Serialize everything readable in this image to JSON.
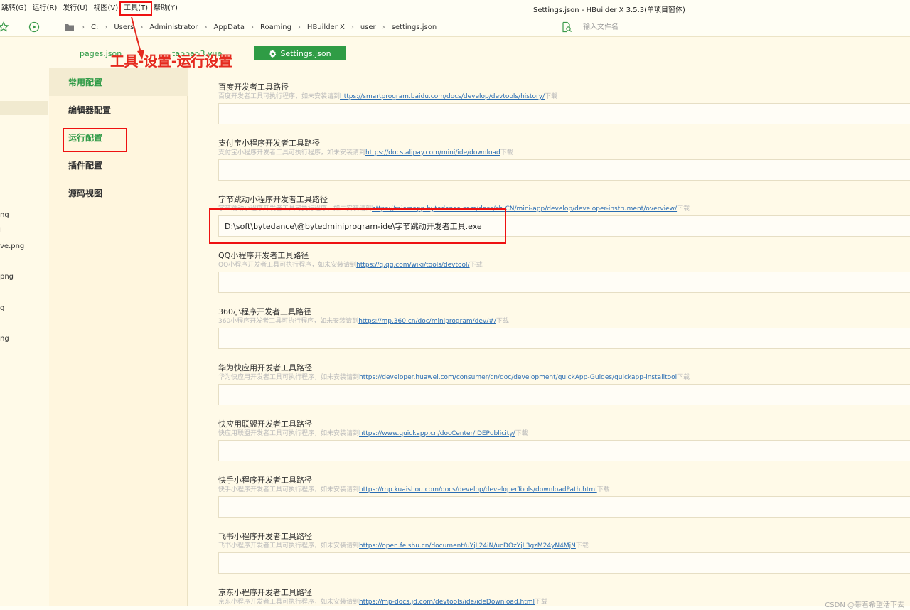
{
  "menubar": {
    "items": [
      "跳转(G)",
      "运行(R)",
      "发行(U)",
      "视图(V)",
      "工具(T)",
      "帮助(Y)"
    ],
    "window_title": "Settings.json - HBuilder X 3.5.3(单项目窗体)"
  },
  "toolbar": {
    "breadcrumbs": [
      "C:",
      "Users",
      "Administrator",
      "AppData",
      "Roaming",
      "HBuilder X",
      "user",
      "settings.json"
    ],
    "file_search_placeholder": "输入文件名"
  },
  "filetree": {
    "items": [
      "ng",
      "l",
      "ve.png",
      "png",
      "g",
      "ng"
    ]
  },
  "tabs": {
    "items": [
      "pages.json",
      "tabbar-3.vue"
    ],
    "active": "Settings.json"
  },
  "annotation": {
    "text": "工具-设置-运行设置",
    "color": "#e52a1f"
  },
  "categories": {
    "items": [
      "常用配置",
      "编辑器配置",
      "运行配置",
      "插件配置",
      "源码视图"
    ]
  },
  "settings": {
    "desc_prefix": "可执行程序，如未安装请到",
    "download_suffix": "下载",
    "fields": [
      {
        "label": "百度开发者工具路径",
        "desc_prefix": "百度开发者工具可执行程序，如未安装请到",
        "url": "https://smartprogram.baidu.com/docs/develop/devtools/history/",
        "suffix": "下载",
        "value": ""
      },
      {
        "label": "支付宝小程序开发者工具路径",
        "desc_prefix": "支付宝小程序开发者工具可执行程序，如未安装请到",
        "url": "https://docs.alipay.com/mini/ide/download",
        "suffix": "下载",
        "value": ""
      },
      {
        "label": "字节跳动小程序开发者工具路径",
        "desc_prefix": "字节跳动小程序开发者工具可执行程序，如未安装请到",
        "url": "https://microapp.bytedance.com/docs/zh-CN/mini-app/develop/developer-instrument/overview/",
        "suffix": "下载",
        "value": "D:\\soft\\bytedance\\@bytedminiprogram-ide\\字节跳动开发者工具.exe"
      },
      {
        "label": "QQ小程序开发者工具路径",
        "desc_prefix": "QQ小程序开发者工具可执行程序，如未安装请到",
        "url": "https://q.qq.com/wiki/tools/devtool/",
        "suffix": "下载",
        "value": ""
      },
      {
        "label": "360小程序开发者工具路径",
        "desc_prefix": "360小程序开发者工具可执行程序，如未安装请到",
        "url": "https://mp.360.cn/doc/miniprogram/dev/#/",
        "suffix": "下载",
        "value": ""
      },
      {
        "label": "华为快应用开发者工具路径",
        "desc_prefix": "华为快应用开发者工具可执行程序，如未安装请到",
        "url": "https://developer.huawei.com/consumer/cn/doc/development/quickApp-Guides/quickapp-installtool",
        "suffix": "下载",
        "value": ""
      },
      {
        "label": "快应用联盟开发者工具路径",
        "desc_prefix": "快应用联盟开发者工具可执行程序，如未安装请到",
        "url": "https://www.quickapp.cn/docCenter/IDEPublicity/",
        "suffix": "下载",
        "value": ""
      },
      {
        "label": "快手小程序开发者工具路径",
        "desc_prefix": "快手小程序开发者工具可执行程序，如未安装请到",
        "url": "https://mp.kuaishou.com/docs/develop/developerTools/downloadPath.html",
        "suffix": "下载",
        "value": ""
      },
      {
        "label": "飞书小程序开发者工具路径",
        "desc_prefix": "飞书小程序开发者工具可执行程序，如未安装请到",
        "url": "https://open.feishu.cn/document/uYjL24iN/ucDOzYjL3gzM24yN4MjN",
        "suffix": "下载",
        "value": ""
      },
      {
        "label": "京东小程序开发者工具路径",
        "desc_prefix": "京东小程序开发者工具可执行程序，如未安装请到",
        "url": "https://mp-docs.jd.com/devtools/ide/ideDownload.html",
        "suffix": "下载",
        "value": ""
      }
    ]
  },
  "watermark": "CSDN @带着希望活下去",
  "colors": {
    "accent": "#2e9a46",
    "background": "#fffae8",
    "annotation": "#e52a1f",
    "link": "#2a6db3"
  },
  "icons": {
    "star": "star-icon",
    "run": "play-circle-icon",
    "folder": "folder-icon",
    "search_file": "file-search-icon",
    "gear": "gear-icon"
  }
}
